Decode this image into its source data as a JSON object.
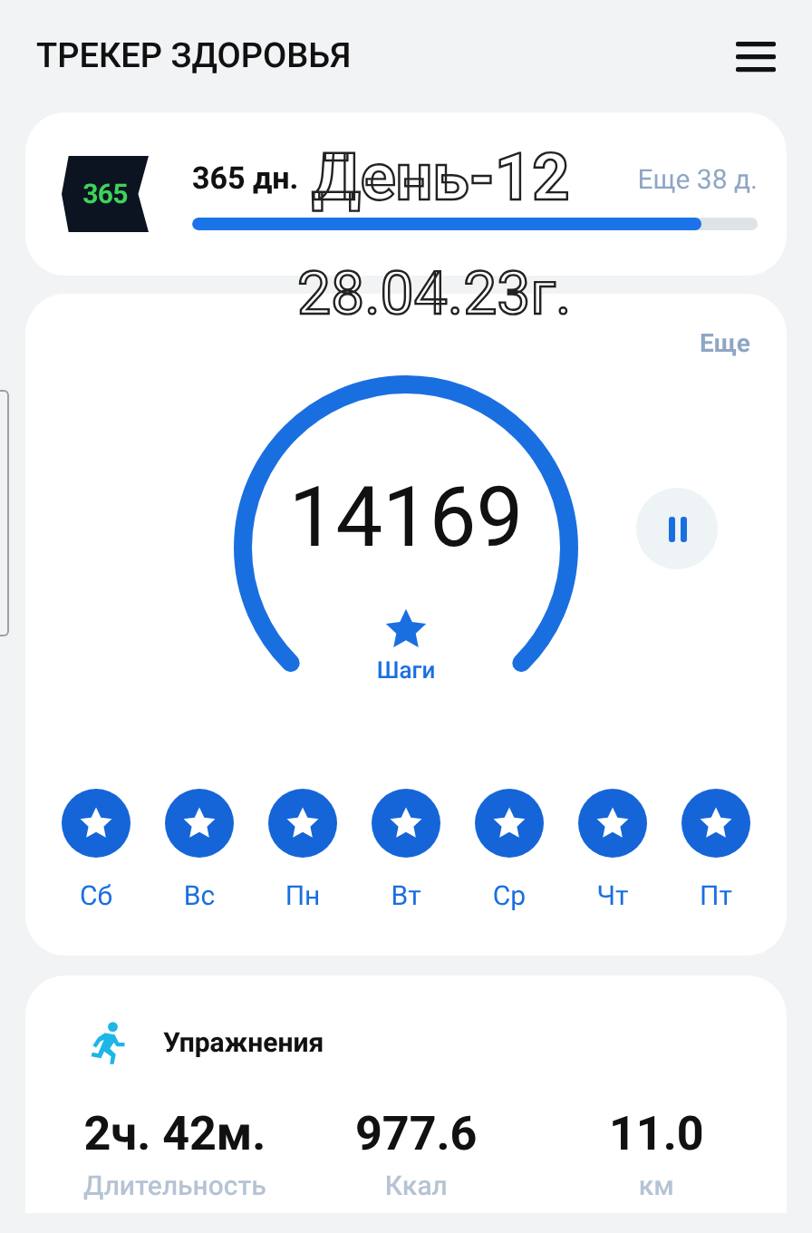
{
  "header": {
    "title": "ТРЕКЕР ЗДОРОВЬЯ"
  },
  "challenge": {
    "badge": "365",
    "title": "365 дн.",
    "remaining": "Еще 38 д.",
    "level": 0.9
  },
  "overlay": [
    "День-12",
    "28.04.23г."
  ],
  "steps": {
    "more": "Еще",
    "value": "14169",
    "label": "Шаги",
    "paused": false
  },
  "days": [
    {
      "label": "Сб",
      "achieved": true
    },
    {
      "label": "Вс",
      "achieved": true
    },
    {
      "label": "Пн",
      "achieved": true
    },
    {
      "label": "Вт",
      "achieved": true
    },
    {
      "label": "Ср",
      "achieved": true
    },
    {
      "label": "Чт",
      "achieved": true
    },
    {
      "label": "Пт",
      "achieved": true
    }
  ],
  "exercise": {
    "title": "Упражнения",
    "stats": [
      {
        "value": "2ч. 42м.",
        "label": "Длительность"
      },
      {
        "value": "977.6",
        "label": "Ккал"
      },
      {
        "value": "11.0",
        "label": "км"
      }
    ]
  }
}
